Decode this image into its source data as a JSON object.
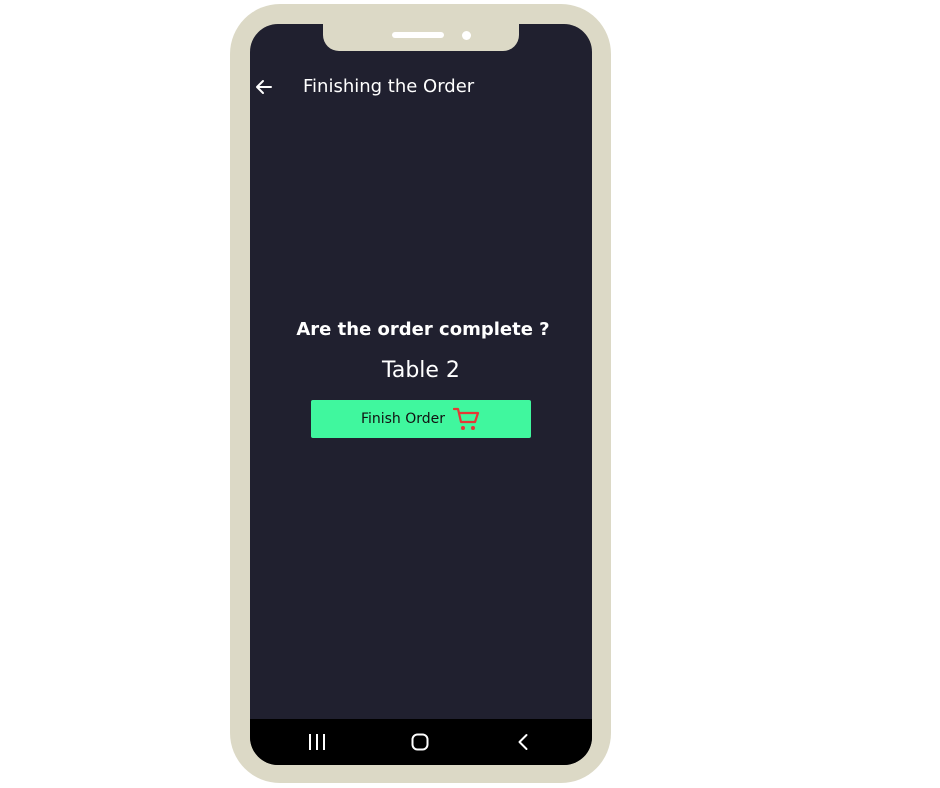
{
  "app_bar": {
    "title": "Finishing the Order",
    "back_icon": "arrow-left-icon"
  },
  "content": {
    "question": "Are the order complete ?",
    "table_label": "Table 2",
    "finish_button": {
      "label": "Finish Order",
      "icon": "shopping-cart-icon",
      "icon_color": "#e53935",
      "background": "#40f79e"
    }
  },
  "nav_bar": {
    "buttons": [
      "recent-apps-icon",
      "home-icon",
      "back-chevron-icon"
    ]
  },
  "colors": {
    "screen_background": "#20202f",
    "frame": "#dcd9c6",
    "text": "#ffffff"
  }
}
